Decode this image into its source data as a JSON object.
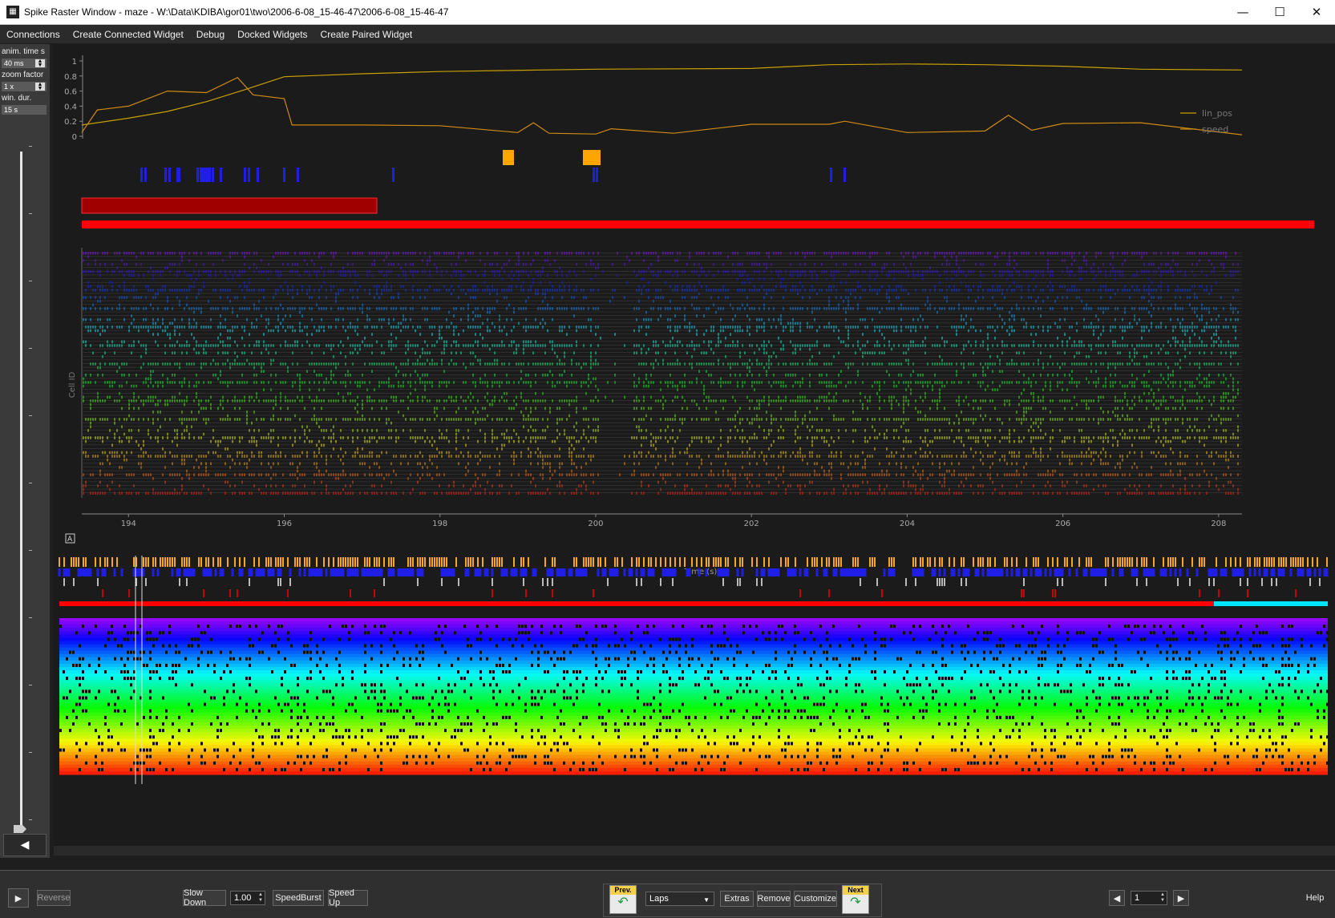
{
  "window": {
    "title": "Spike Raster Window - maze - W:\\Data\\KDIBA\\gor01\\two\\2006-6-08_15-46-47\\2006-6-08_15-46-47",
    "minimize": "—",
    "maximize": "☐",
    "close": "✕"
  },
  "menu": [
    "Connections",
    "Create Connected Widget",
    "Debug",
    "Docked Widgets",
    "Create Paired Widget"
  ],
  "left_panel": {
    "anim_time_label": "anim. time s",
    "anim_time_value": "40 ms",
    "zoom_factor_label": "zoom factor",
    "zoom_factor_value": "1 x",
    "win_dur_label": "win. dur.",
    "win_dur_value": "15 s",
    "collapse_icon": "◀"
  },
  "plot": {
    "y_label": "Cell ID",
    "x_label": "Time (s)",
    "x_ticks": [
      "194",
      "196",
      "198",
      "200",
      "202",
      "204",
      "206",
      "208"
    ],
    "y_ticks": [
      "1",
      "0.8",
      "0.6",
      "0.4",
      "0.2",
      "0"
    ],
    "legend": [
      "lin_pos",
      "speed"
    ],
    "overview_icon": "A"
  },
  "toolbar": {
    "play_icon": "▶",
    "reverse": "Reverse",
    "slow_down": "Slow Down",
    "speed_value": "1.00",
    "speed_burst": "SpeedBurst",
    "speed_up": "Speed Up",
    "prev": "Prev.",
    "next": "Next",
    "epoch_select": "Laps",
    "extras": "Extras",
    "remove": "Remove",
    "customize": "Customize",
    "page_value": "1",
    "help": "Help",
    "left_icon": "◀",
    "right_icon": "▶"
  },
  "colors": {
    "lin_pos": "#c8a000",
    "speed": "#d08a10",
    "epoch_red": "#ff0000",
    "laps_blue": "#1e1ee6",
    "orange_epoch": "#ffa500",
    "cyan": "#00e5ff"
  },
  "chart_data": {
    "type": "line",
    "x_range": [
      193.4,
      208.3
    ],
    "y_range": [
      0,
      1
    ],
    "series": [
      {
        "name": "lin_pos",
        "x": [
          193.4,
          194.0,
          194.5,
          195.0,
          195.5,
          196.0,
          197.0,
          198.0,
          200.0,
          202.0,
          203.0,
          204.0,
          205.0,
          206.0,
          207.0,
          208.3
        ],
        "y": [
          0.15,
          0.24,
          0.33,
          0.46,
          0.62,
          0.79,
          0.83,
          0.86,
          0.89,
          0.9,
          0.95,
          0.96,
          0.95,
          0.93,
          0.89,
          0.88
        ]
      },
      {
        "name": "speed",
        "x": [
          193.4,
          193.6,
          194.0,
          194.5,
          195.0,
          195.4,
          195.6,
          196.0,
          196.1,
          197.0,
          198.0,
          199.0,
          199.2,
          199.4,
          200.0,
          200.2,
          201.0,
          202.0,
          203.0,
          203.2,
          204.0,
          205.0,
          205.3,
          205.6,
          206.0,
          207.0,
          208.3
        ],
        "y": [
          0.05,
          0.35,
          0.4,
          0.6,
          0.58,
          0.78,
          0.55,
          0.5,
          0.15,
          0.15,
          0.14,
          0.05,
          0.18,
          0.04,
          0.03,
          0.1,
          0.04,
          0.16,
          0.16,
          0.2,
          0.05,
          0.07,
          0.28,
          0.08,
          0.17,
          0.18,
          0.02
        ]
      }
    ]
  }
}
